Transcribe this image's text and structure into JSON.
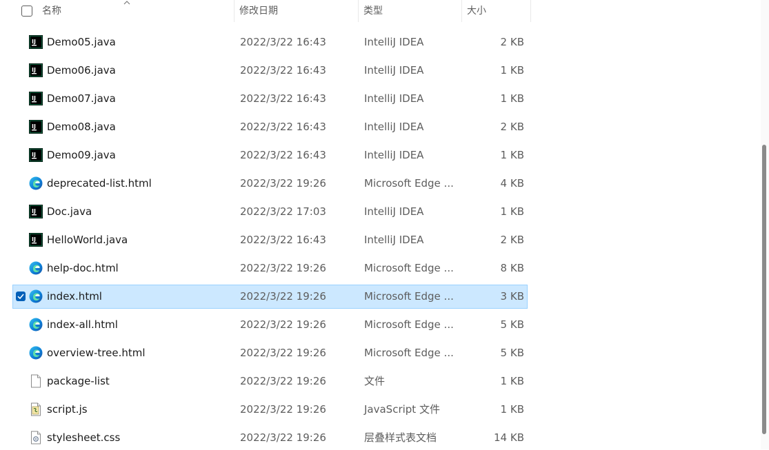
{
  "header": {
    "name": "名称",
    "date": "修改日期",
    "type": "类型",
    "size": "大小"
  },
  "files": [
    {
      "name": "Demo05.java",
      "date": "2022/3/22 16:43",
      "type": "IntelliJ IDEA",
      "size": "2 KB",
      "icon": "intellij-icon"
    },
    {
      "name": "Demo06.java",
      "date": "2022/3/22 16:43",
      "type": "IntelliJ IDEA",
      "size": "1 KB",
      "icon": "intellij-icon"
    },
    {
      "name": "Demo07.java",
      "date": "2022/3/22 16:43",
      "type": "IntelliJ IDEA",
      "size": "1 KB",
      "icon": "intellij-icon"
    },
    {
      "name": "Demo08.java",
      "date": "2022/3/22 16:43",
      "type": "IntelliJ IDEA",
      "size": "2 KB",
      "icon": "intellij-icon"
    },
    {
      "name": "Demo09.java",
      "date": "2022/3/22 16:43",
      "type": "IntelliJ IDEA",
      "size": "1 KB",
      "icon": "intellij-icon"
    },
    {
      "name": "deprecated-list.html",
      "date": "2022/3/22 19:26",
      "type": "Microsoft Edge ...",
      "size": "4 KB",
      "icon": "edge-icon"
    },
    {
      "name": "Doc.java",
      "date": "2022/3/22 17:03",
      "type": "IntelliJ IDEA",
      "size": "1 KB",
      "icon": "intellij-icon"
    },
    {
      "name": "HelloWorld.java",
      "date": "2022/3/22 16:43",
      "type": "IntelliJ IDEA",
      "size": "2 KB",
      "icon": "intellij-icon"
    },
    {
      "name": "help-doc.html",
      "date": "2022/3/22 19:26",
      "type": "Microsoft Edge ...",
      "size": "8 KB",
      "icon": "edge-icon"
    },
    {
      "name": "index.html",
      "date": "2022/3/22 19:26",
      "type": "Microsoft Edge ...",
      "size": "3 KB",
      "icon": "edge-icon",
      "selected": true
    },
    {
      "name": "index-all.html",
      "date": "2022/3/22 19:26",
      "type": "Microsoft Edge ...",
      "size": "5 KB",
      "icon": "edge-icon"
    },
    {
      "name": "overview-tree.html",
      "date": "2022/3/22 19:26",
      "type": "Microsoft Edge ...",
      "size": "5 KB",
      "icon": "edge-icon"
    },
    {
      "name": "package-list",
      "date": "2022/3/22 19:26",
      "type": "文件",
      "size": "1 KB",
      "icon": "file-icon"
    },
    {
      "name": "script.js",
      "date": "2022/3/22 19:26",
      "type": "JavaScript 文件",
      "size": "1 KB",
      "icon": "script-file-icon"
    },
    {
      "name": "stylesheet.css",
      "date": "2022/3/22 19:26",
      "type": "层叠样式表文档",
      "size": "14 KB",
      "icon": "css-file-icon"
    }
  ],
  "colors": {
    "selection_bg": "#cce8ff",
    "selection_border": "#99d1ff",
    "accent": "#005fb8"
  }
}
